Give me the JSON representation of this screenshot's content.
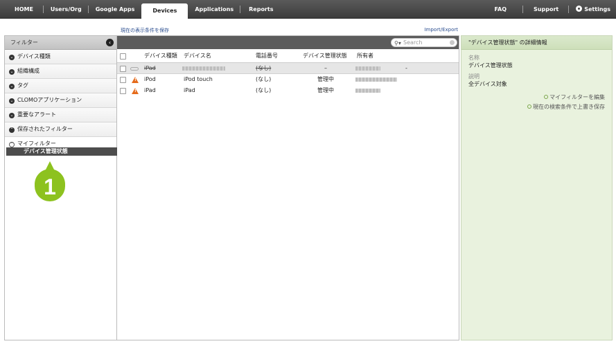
{
  "nav": {
    "left": [
      "HOME",
      "Users/Org",
      "Google Apps",
      "Devices",
      "Applications",
      "Reports"
    ],
    "active": "Devices",
    "right": [
      "FAQ",
      "Support",
      "Settings"
    ]
  },
  "links": {
    "save_view": "現在の表示条件を保存",
    "import_export": "Import/Export"
  },
  "sidebar": {
    "title": "フィルター",
    "items": [
      "デバイス種類",
      "組織構成",
      "タグ",
      "CLOMOアプリケーション",
      "重要なアラート",
      "保存されたフィルター"
    ],
    "my_filter": "マイフィルター",
    "selected_filter": "デバイス管理状態",
    "badge_number": "1"
  },
  "search": {
    "placeholder": "Search"
  },
  "table": {
    "headers": [
      "デバイス種類",
      "デバイス名",
      "電話番号",
      "デバイス管理状態",
      "所有者"
    ],
    "rows": [
      {
        "type": "iPad",
        "name": "",
        "phone": "(なし)",
        "status": "–",
        "owner": "",
        "extra": "-"
      },
      {
        "type": "iPod",
        "name": "iPod touch",
        "phone": "(なし)",
        "status": "管理中",
        "owner": ""
      },
      {
        "type": "iPad",
        "name": "iPad",
        "phone": "(なし)",
        "status": "管理中",
        "owner": ""
      }
    ]
  },
  "detail": {
    "title": "\"デバイス管理状態\" の詳細情報",
    "name_label": "名称",
    "name_value": "デバイス管理状態",
    "desc_label": "説明",
    "desc_value": "全デバイス対象",
    "actions": [
      "マイフィルターを編集",
      "現在の検索条件で上書き保存"
    ]
  },
  "colors": {
    "badge": "#8dc21f",
    "nav_bg": "#4a4a4a",
    "detail_bg": "#e9f2de",
    "warning": "#e56a1a"
  }
}
